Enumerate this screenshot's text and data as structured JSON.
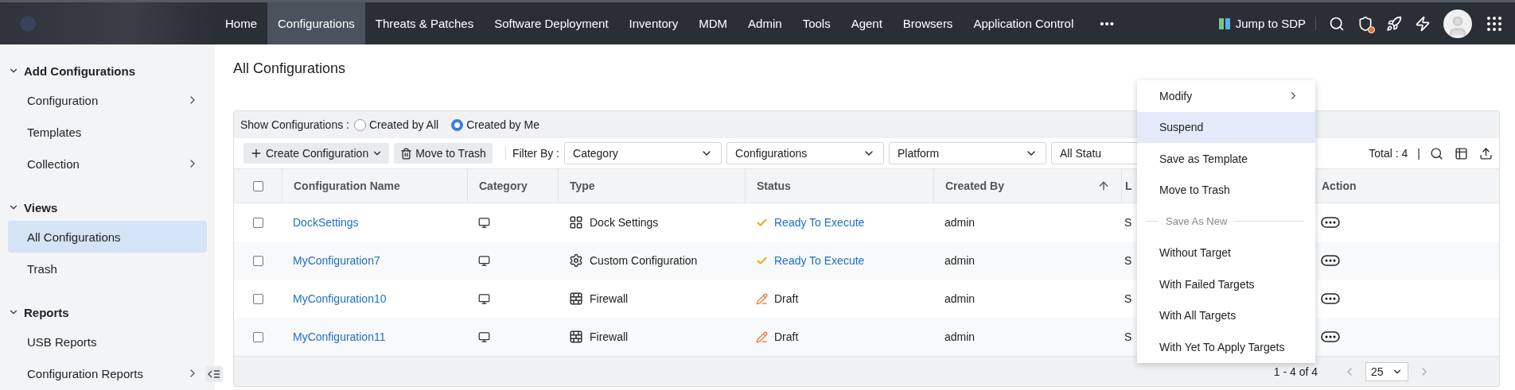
{
  "topbar": {
    "nav": [
      {
        "label": "Home",
        "selected": false
      },
      {
        "label": "Configurations",
        "selected": true
      },
      {
        "label": "Threats & Patches",
        "selected": false
      },
      {
        "label": "Software Deployment",
        "selected": false
      },
      {
        "label": "Inventory",
        "selected": false
      },
      {
        "label": "MDM",
        "selected": false
      },
      {
        "label": "Admin",
        "selected": false
      },
      {
        "label": "Tools",
        "selected": false
      },
      {
        "label": "Agent",
        "selected": false
      },
      {
        "label": "Browsers",
        "selected": false
      },
      {
        "label": "Application Control",
        "selected": false
      }
    ],
    "more": "•••",
    "jump_label": "Jump to SDP"
  },
  "sidebar": {
    "sections": [
      {
        "title": "Add Configurations",
        "expanded": true,
        "children": [
          {
            "label": "Configuration",
            "has_submenu": true,
            "selected": false
          },
          {
            "label": "Templates",
            "has_submenu": false,
            "selected": false
          },
          {
            "label": "Collection",
            "has_submenu": true,
            "selected": false
          }
        ]
      },
      {
        "title": "Views",
        "expanded": true,
        "children": [
          {
            "label": "All Configurations",
            "has_submenu": false,
            "selected": true
          },
          {
            "label": "Trash",
            "has_submenu": false,
            "selected": false
          }
        ]
      },
      {
        "title": "Reports",
        "expanded": true,
        "children": [
          {
            "label": "USB Reports",
            "has_submenu": false,
            "selected": false
          },
          {
            "label": "Configuration Reports",
            "has_submenu": true,
            "selected": false
          }
        ]
      }
    ]
  },
  "page_title": "All Configurations",
  "show_filter": {
    "label": "Show Configurations :",
    "options": [
      {
        "label": "Created by All",
        "selected": false
      },
      {
        "label": "Created by Me",
        "selected": true
      }
    ]
  },
  "toolbar": {
    "create_button": "Create Configuration",
    "trash_button": "Move to Trash",
    "filter_label": "Filter By :",
    "filters": [
      "Category",
      "Configurations",
      "Platform",
      "All Statu"
    ],
    "total": "Total : 4",
    "separator": "|"
  },
  "table": {
    "header_checked": false,
    "columns": [
      {
        "label": "Configuration Name",
        "sorted": false
      },
      {
        "label": "Category",
        "sorted": false
      },
      {
        "label": "Type",
        "sorted": false
      },
      {
        "label": "Status",
        "sorted": false
      },
      {
        "label": "Created By",
        "sorted": true
      },
      {
        "label": "L",
        "sorted": false
      },
      {
        "label": "Action",
        "sorted": false
      }
    ],
    "rows": [
      {
        "checked": false,
        "name": "DockSettings",
        "type": {
          "kind": "dock",
          "label": "Dock Settings"
        },
        "status": {
          "kind": "ready",
          "label": "Ready To Execute"
        },
        "created_by": "admin",
        "column_6": "S"
      },
      {
        "checked": false,
        "name": "MyConfiguration7",
        "type": {
          "kind": "custom",
          "label": "Custom Configuration"
        },
        "status": {
          "kind": "ready",
          "label": "Ready To Execute"
        },
        "created_by": "admin",
        "column_6": "S"
      },
      {
        "checked": false,
        "name": "MyConfiguration10",
        "type": {
          "kind": "firewall",
          "label": "Firewall"
        },
        "status": {
          "kind": "draft",
          "label": "Draft"
        },
        "created_by": "admin",
        "column_6": "S"
      },
      {
        "checked": false,
        "name": "MyConfiguration11",
        "type": {
          "kind": "firewall",
          "label": "Firewall"
        },
        "status": {
          "kind": "draft",
          "label": "Draft"
        },
        "created_by": "admin",
        "column_6": "S"
      }
    ]
  },
  "pagination": {
    "range": "1 - 4 of 4",
    "page_size": "25"
  },
  "action_menu": {
    "items": [
      {
        "kind": "submenu",
        "label": "Modify",
        "selected": false
      },
      {
        "kind": "item",
        "label": "Suspend",
        "selected": true
      },
      {
        "kind": "item",
        "label": "Save as Template",
        "selected": false
      },
      {
        "kind": "item",
        "label": "Move to Trash",
        "selected": false
      },
      {
        "kind": "header",
        "label": "Save As New",
        "selected": false
      },
      {
        "kind": "item",
        "label": "Without Target",
        "selected": false
      },
      {
        "kind": "item",
        "label": "With Failed Targets",
        "selected": false
      },
      {
        "kind": "item",
        "label": "With All Targets",
        "selected": false
      },
      {
        "kind": "item",
        "label": "With Yet To Apply Targets",
        "selected": false
      }
    ]
  }
}
